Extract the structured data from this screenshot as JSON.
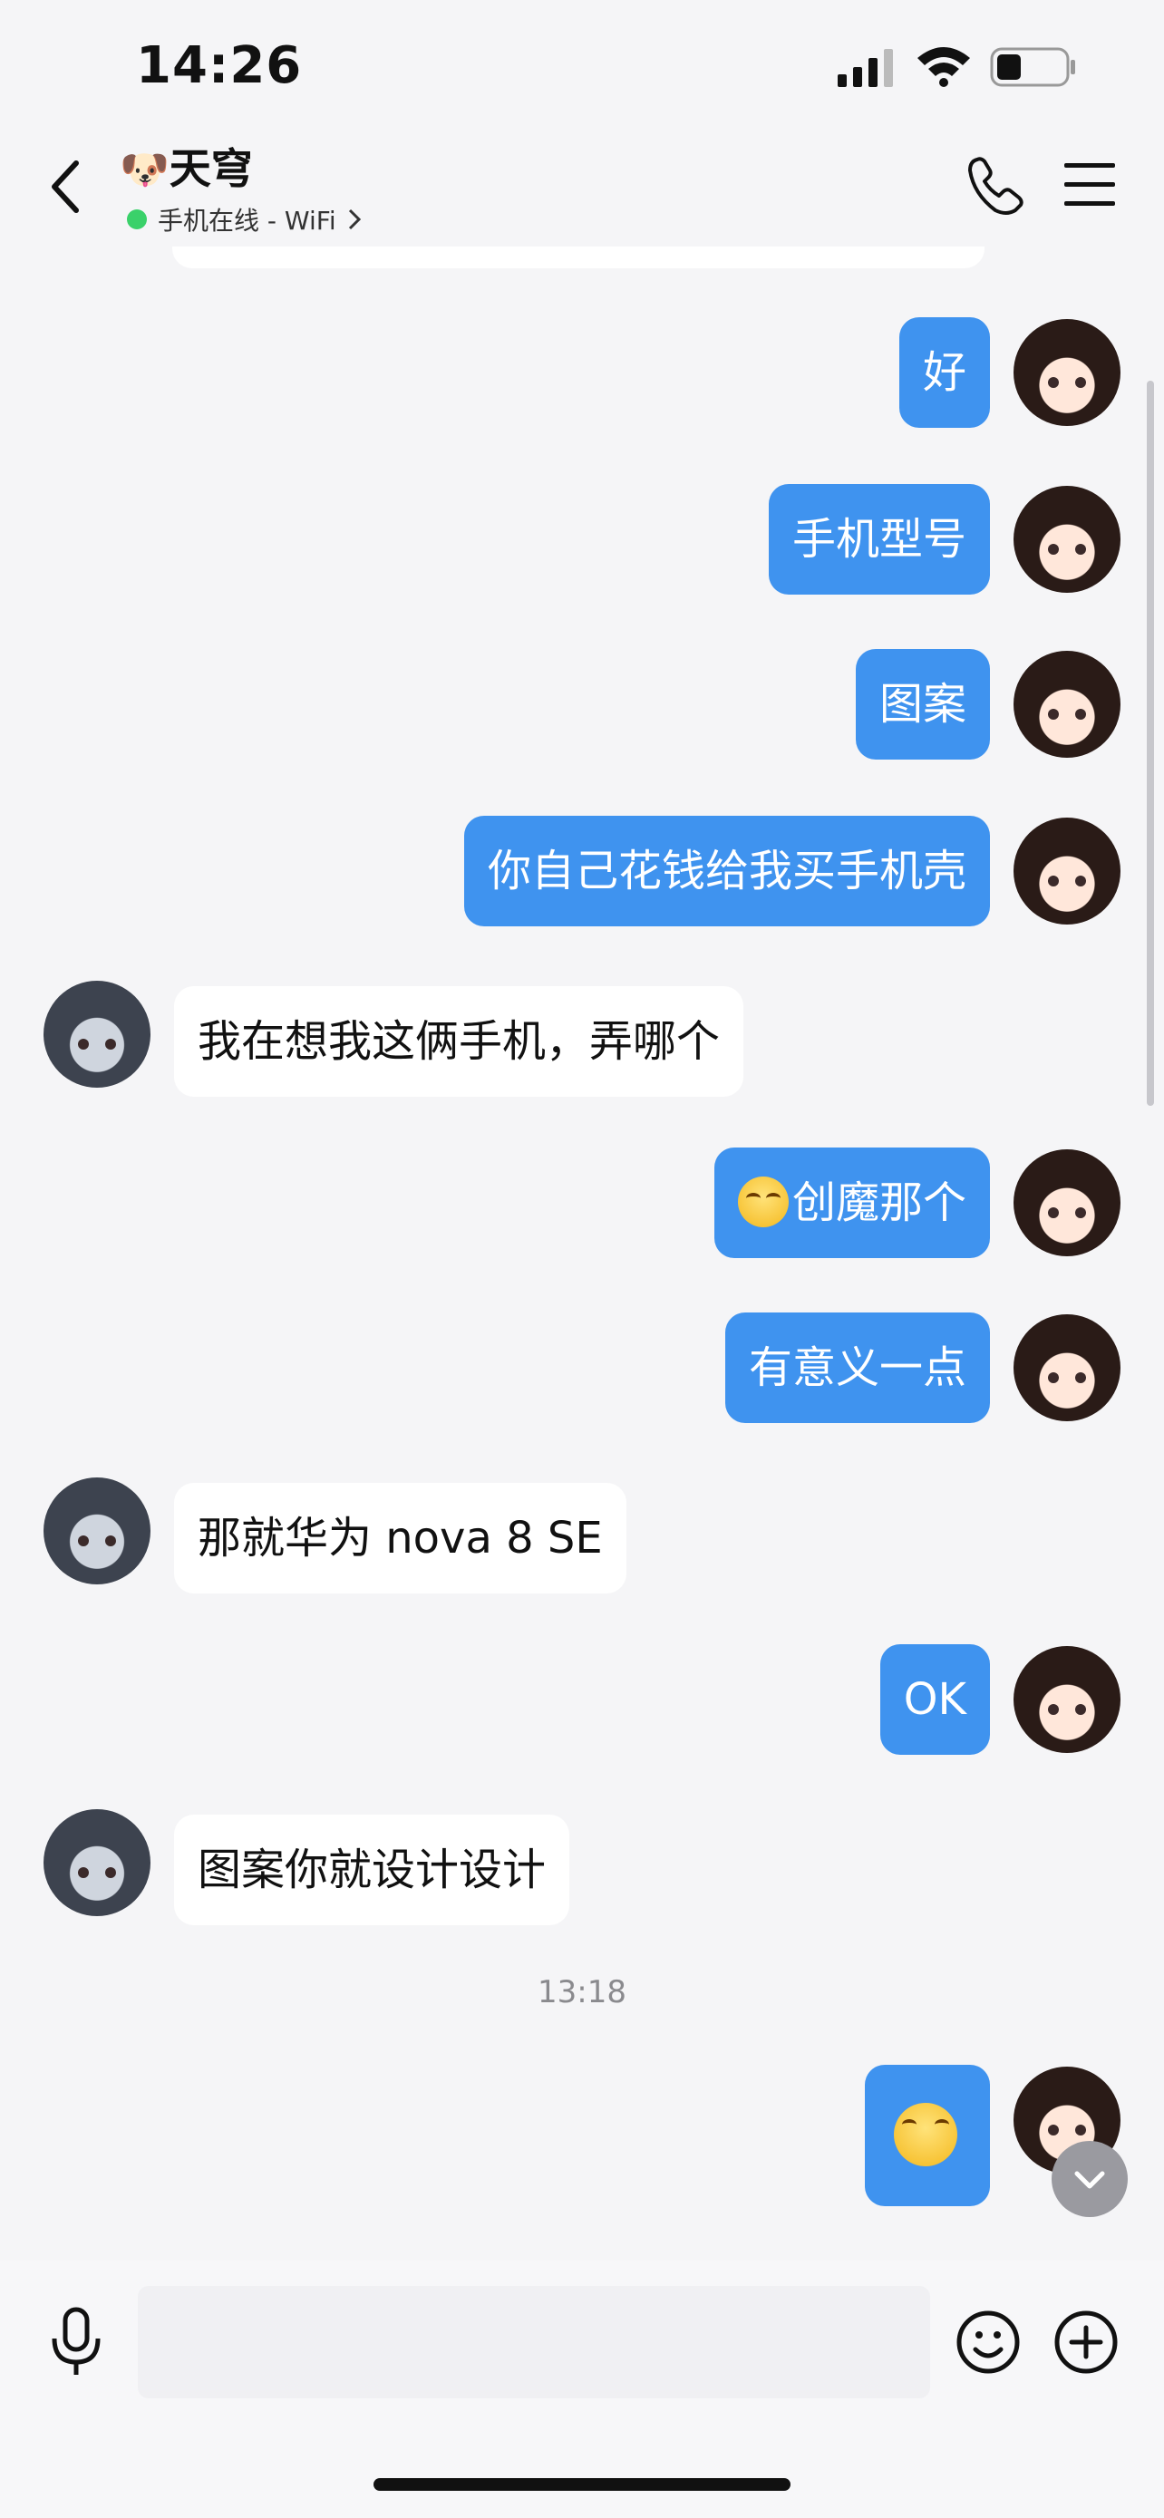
{
  "status_bar": {
    "time": "14:26"
  },
  "header": {
    "title_emoji": "🐶",
    "title": "天穹",
    "subtitle": "手机在线 - WiFi",
    "online_color": "#3ad16a"
  },
  "messages": [
    {
      "side": "me",
      "text": "好"
    },
    {
      "side": "me",
      "text": "手机型号"
    },
    {
      "side": "me",
      "text": "图案"
    },
    {
      "side": "me",
      "text": "你自己花钱给我买手机壳"
    },
    {
      "side": "other",
      "text": "我在想我这俩手机，弄哪个"
    },
    {
      "side": "me",
      "text": "创魔那个",
      "emoji": "smirk-emoji"
    },
    {
      "side": "me",
      "text": "有意义一点"
    },
    {
      "side": "other",
      "text": "那就华为 nova 8 SE"
    },
    {
      "side": "me",
      "text": "OK"
    },
    {
      "side": "other",
      "text": "图案你就设计设计"
    },
    {
      "side": "me",
      "text": "",
      "emoji": "smirk-emoji"
    }
  ],
  "timestamp": "13:18",
  "input": {
    "placeholder": ""
  },
  "colors": {
    "accent": "#3f93ef",
    "background": "#f5f5f7"
  }
}
